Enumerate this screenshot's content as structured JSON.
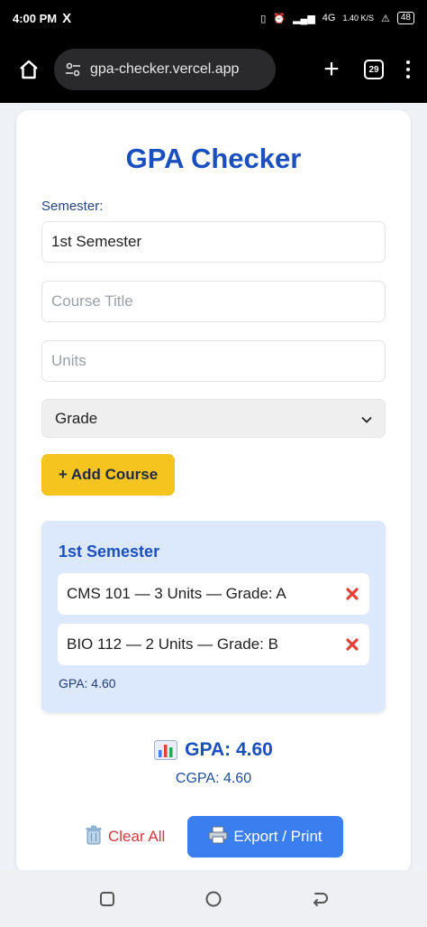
{
  "status_bar": {
    "time": "4:00 PM",
    "app_icon": "X",
    "network": "4G",
    "speed": "1.40 K/S",
    "battery": "48"
  },
  "browser": {
    "url": "gpa-checker.vercel.app",
    "tab_count": "29"
  },
  "app": {
    "title": "GPA Checker",
    "semester_label": "Semester:",
    "semester_value": "1st Semester",
    "course_title_placeholder": "Course Title",
    "units_placeholder": "Units",
    "grade_select_value": "Grade",
    "add_course_label": "+ Add Course"
  },
  "semester_block": {
    "title": "1st Semester",
    "courses": [
      {
        "text": "CMS 101 — 3 Units — Grade: A"
      },
      {
        "text": "BIO 112 — 2 Units — Grade: B"
      }
    ],
    "gpa_text": "GPA: 4.60"
  },
  "summary": {
    "gpa_text": "GPA: 4.60",
    "cgpa_text": "CGPA: 4.60"
  },
  "actions": {
    "clear_label": "Clear All",
    "export_label": "Export / Print"
  },
  "colors": {
    "primary": "#1a4fbf",
    "accent_yellow": "#f6c41f",
    "export_blue": "#3a7ef0",
    "danger": "#d23a3a"
  }
}
